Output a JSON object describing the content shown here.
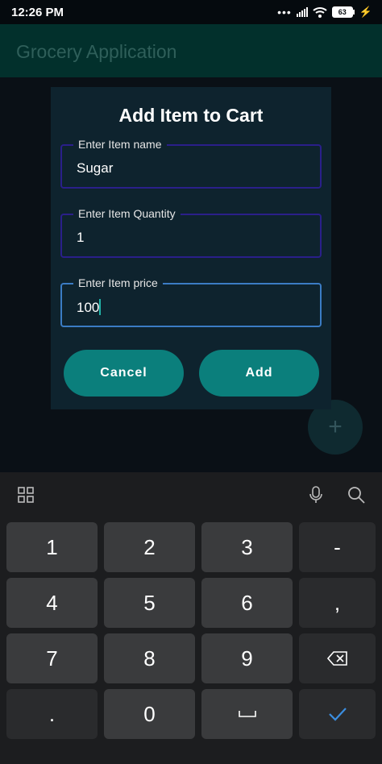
{
  "status_bar": {
    "time": "12:26 PM",
    "battery": "63"
  },
  "app_bar": {
    "title": "Grocery Application"
  },
  "fab": {
    "icon": "+"
  },
  "dialog": {
    "title": "Add Item to Cart",
    "fields": [
      {
        "label": "Enter Item name",
        "value": "Sugar"
      },
      {
        "label": "Enter Item Quantity",
        "value": "1"
      },
      {
        "label": "Enter Item price",
        "value": "100"
      }
    ],
    "cancel_label": "Cancel",
    "add_label": "Add"
  },
  "keyboard": {
    "keys": [
      "1",
      "2",
      "3",
      "-",
      "4",
      "5",
      "6",
      ",",
      "7",
      "8",
      "9",
      "backspace",
      ".",
      "0",
      "space",
      "done"
    ],
    "labels": {
      "k1": "1",
      "k2": "2",
      "k3": "3",
      "dash": "-",
      "k4": "4",
      "k5": "5",
      "k6": "6",
      "comma": ",",
      "k7": "7",
      "k8": "8",
      "k9": "9",
      "dot": ".",
      "k0": "0"
    }
  },
  "colors": {
    "accent": "#0b7f7c",
    "focus_border": "#3b7cc4",
    "field_border": "#2a1f8a"
  }
}
